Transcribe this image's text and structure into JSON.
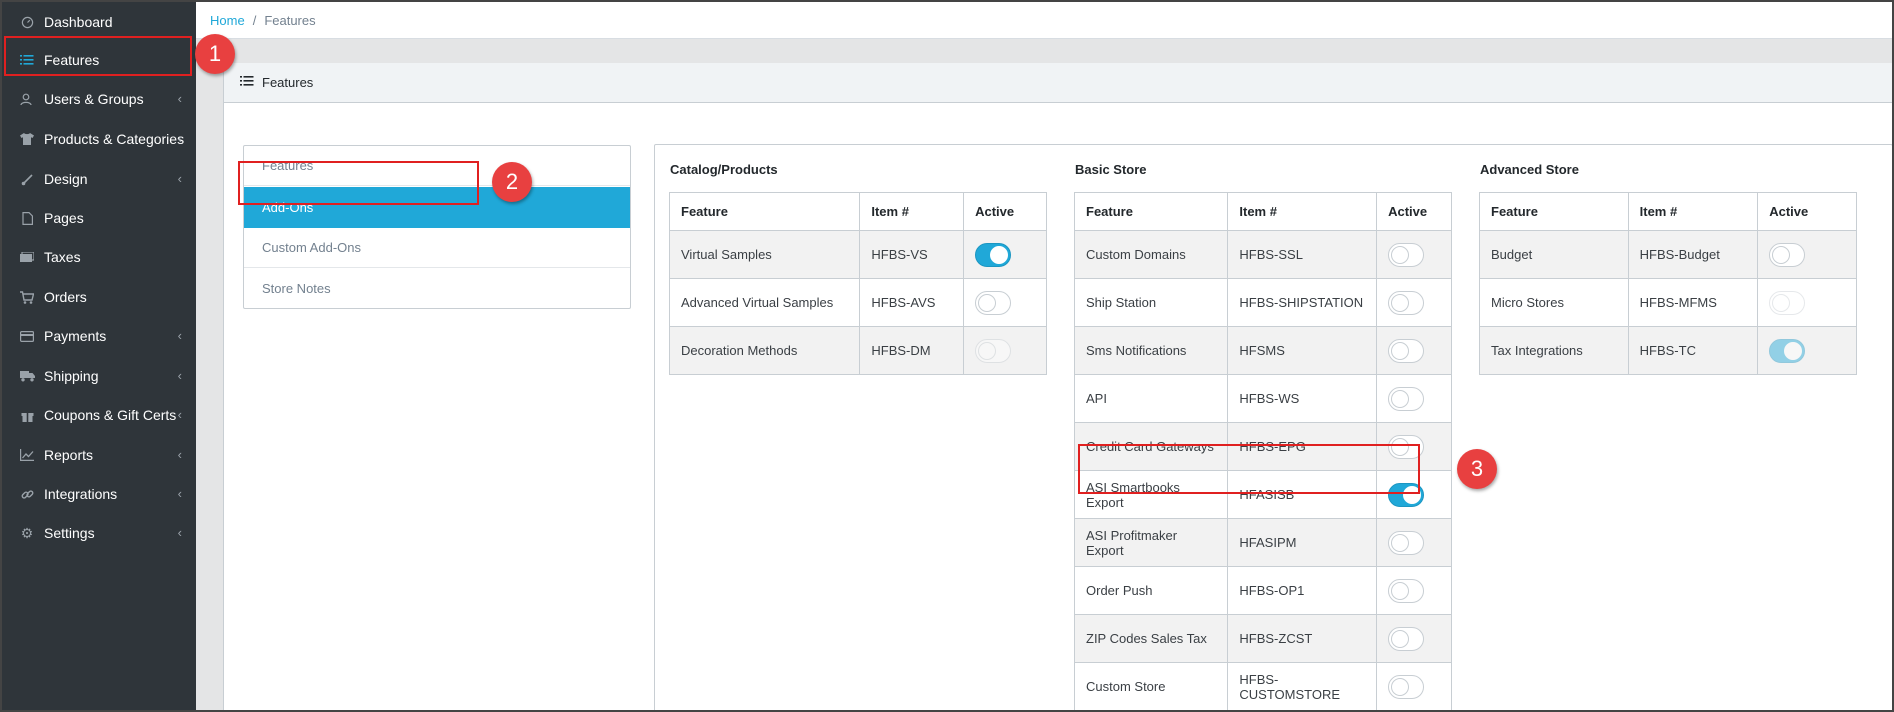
{
  "sidebar": {
    "items": [
      {
        "label": "Dashboard",
        "icon": "dashboard-icon",
        "chevron": false,
        "active": false
      },
      {
        "label": "Features",
        "icon": "list-icon",
        "chevron": false,
        "active": true
      },
      {
        "label": "Users & Groups",
        "icon": "users-icon",
        "chevron": true,
        "active": false
      },
      {
        "label": "Products & Categories",
        "icon": "shirt-icon",
        "chevron": true,
        "active": false
      },
      {
        "label": "Design",
        "icon": "brush-icon",
        "chevron": true,
        "active": false
      },
      {
        "label": "Pages",
        "icon": "page-icon",
        "chevron": false,
        "active": false
      },
      {
        "label": "Taxes",
        "icon": "money-icon",
        "chevron": false,
        "active": false
      },
      {
        "label": "Orders",
        "icon": "cart-icon",
        "chevron": false,
        "active": false
      },
      {
        "label": "Payments",
        "icon": "credit-card-icon",
        "chevron": true,
        "active": false
      },
      {
        "label": "Shipping",
        "icon": "truck-icon",
        "chevron": true,
        "active": false
      },
      {
        "label": "Coupons & Gift Certs",
        "icon": "gift-icon",
        "chevron": true,
        "active": false
      },
      {
        "label": "Reports",
        "icon": "chart-icon",
        "chevron": true,
        "active": false
      },
      {
        "label": "Integrations",
        "icon": "link-icon",
        "chevron": true,
        "active": false
      },
      {
        "label": "Settings",
        "icon": "gear-icon",
        "chevron": true,
        "active": false
      }
    ]
  },
  "breadcrumb": {
    "home": "Home",
    "separator": "/",
    "current": "Features"
  },
  "card": {
    "title": "Features"
  },
  "subnav": {
    "items": [
      {
        "label": "Features",
        "active": false
      },
      {
        "label": "Add-Ons",
        "active": true
      },
      {
        "label": "Custom Add-Ons",
        "active": false
      },
      {
        "label": "Store Notes",
        "active": false
      }
    ]
  },
  "tables": {
    "headers": {
      "feature": "Feature",
      "item": "Item #",
      "active": "Active"
    },
    "catalog": {
      "title": "Catalog/Products",
      "rows": [
        {
          "feature": "Virtual Samples",
          "item": "HFBS-VS",
          "state": "on"
        },
        {
          "feature": "Advanced Virtual Samples",
          "item": "HFBS-AVS",
          "state": "off"
        },
        {
          "feature": "Decoration Methods",
          "item": "HFBS-DM",
          "state": "disabled"
        }
      ]
    },
    "basic": {
      "title": "Basic Store",
      "rows": [
        {
          "feature": "Custom Domains",
          "item": "HFBS-SSL",
          "state": "off"
        },
        {
          "feature": "Ship Station",
          "item": "HFBS-SHIPSTATION",
          "state": "off"
        },
        {
          "feature": "Sms Notifications",
          "item": "HFSMS",
          "state": "off"
        },
        {
          "feature": "API",
          "item": "HFBS-WS",
          "state": "off"
        },
        {
          "feature": "Credit Card Gateways",
          "item": "HFBS-EPG",
          "state": "off"
        },
        {
          "feature": "ASI Smartbooks Export",
          "item": "HFASISB",
          "state": "on"
        },
        {
          "feature": "ASI Profitmaker Export",
          "item": "HFASIPM",
          "state": "off"
        },
        {
          "feature": "Order Push",
          "item": "HFBS-OP1",
          "state": "off"
        },
        {
          "feature": "ZIP Codes Sales Tax",
          "item": "HFBS-ZCST",
          "state": "off"
        },
        {
          "feature": "Custom Store",
          "item": "HFBS-CUSTOMSTORE",
          "state": "off"
        }
      ]
    },
    "advanced": {
      "title": "Advanced Store",
      "rows": [
        {
          "feature": "Budget",
          "item": "HFBS-Budget",
          "state": "off"
        },
        {
          "feature": "Micro Stores",
          "item": "HFBS-MFMS",
          "state": "disabled"
        },
        {
          "feature": "Tax Integrations",
          "item": "HFBS-TC",
          "state": "on-disabled"
        }
      ]
    }
  },
  "annotations": {
    "one": "1",
    "two": "2",
    "three": "3"
  },
  "colors": {
    "accent": "#20a8d8",
    "sidebar": "#2f353a",
    "annotation": "#e02020"
  }
}
